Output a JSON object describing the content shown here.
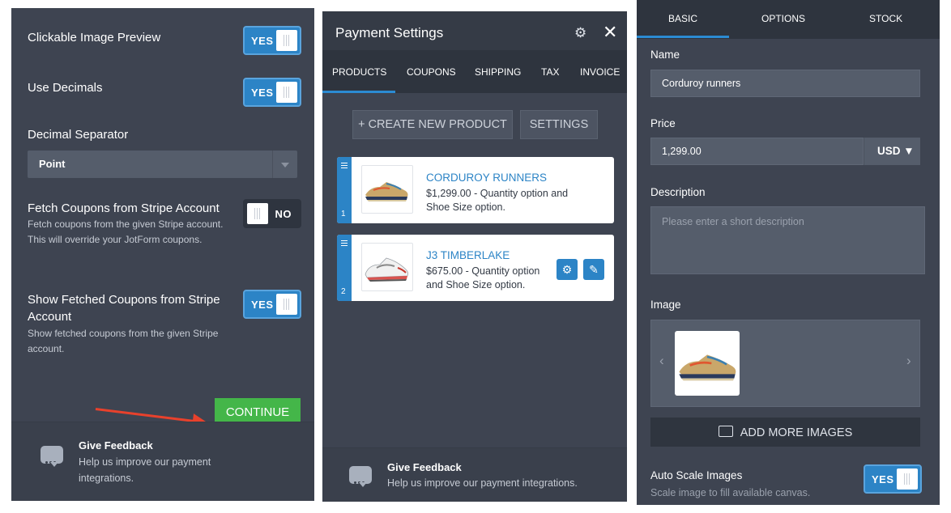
{
  "panel1": {
    "clickable_label": "Clickable Image Preview",
    "clickable_toggle": "YES",
    "decimals_label": "Use Decimals",
    "decimals_toggle": "YES",
    "separator_label": "Decimal Separator",
    "separator_value": "Point",
    "fetch_label": "Fetch Coupons from Stripe Account",
    "fetch_desc": "Fetch coupons from the given Stripe account. This will override your JotForm coupons.",
    "fetch_toggle": "NO",
    "show_label": "Show Fetched Coupons from Stripe Account",
    "show_desc": "Show fetched coupons from the given Stripe account.",
    "show_toggle": "YES",
    "continue_label": "CONTINUE",
    "feedback_title": "Give Feedback",
    "feedback_text": "Help us improve our payment integrations."
  },
  "panel2": {
    "title": "Payment Settings",
    "tabs": [
      "PRODUCTS",
      "COUPONS",
      "SHIPPING",
      "TAX",
      "INVOICE"
    ],
    "create_label": "+ CREATE NEW PRODUCT",
    "settings_label": "SETTINGS",
    "products": [
      {
        "index": "1",
        "name": "CORDUROY RUNNERS",
        "desc": "$1,299.00 - Quantity option and Shoe Size option."
      },
      {
        "index": "2",
        "name": "J3 TIMBERLAKE",
        "desc": "$675.00 - Quantity option and Shoe Size option."
      }
    ],
    "feedback_title": "Give Feedback",
    "feedback_text": "Help us improve our payment integrations."
  },
  "panel3": {
    "tabs": [
      "BASIC",
      "OPTIONS",
      "STOCK"
    ],
    "name_label": "Name",
    "name_value": "Corduroy runners",
    "price_label": "Price",
    "price_value": "1,299.00",
    "currency": "USD ▼",
    "description_label": "Description",
    "description_placeholder": "Please enter a short description",
    "image_label": "Image",
    "add_images_label": "ADD MORE IMAGES",
    "auto_scale_label": "Auto Scale Images",
    "auto_scale_desc": "Scale image to fill available canvas.",
    "auto_scale_toggle": "YES"
  },
  "colors": {
    "panel_bg": "#3e4451",
    "accent_blue": "#2c84c6",
    "continue_green": "#44b649",
    "arrow_red": "#e8412c"
  }
}
